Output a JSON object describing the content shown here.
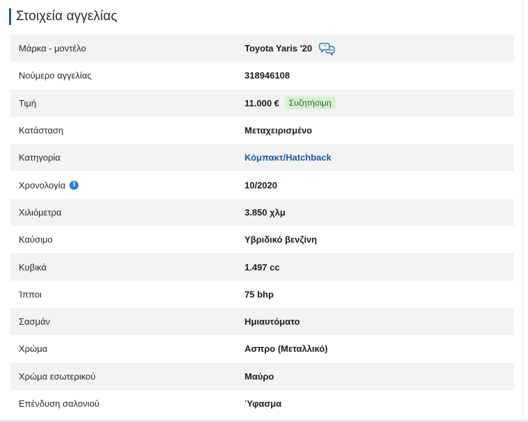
{
  "section": {
    "title": "Στοιχεία αγγελίας",
    "accent_color": "#2354a5"
  },
  "details": {
    "brand_model": {
      "label": "Μάρκα - μοντέλο",
      "value": "Toyota Yaris '20",
      "icon": "chat-bubbles-icon"
    },
    "listing_number": {
      "label": "Νούμερο αγγελίας",
      "value": "318946108"
    },
    "price": {
      "label": "Τιμή",
      "value": "11.000 €",
      "badge": "Συζητήσιμη",
      "badge_color": "#d8f0d4"
    },
    "condition": {
      "label": "Κατάσταση",
      "value": "Μεταχειρισμένο"
    },
    "category": {
      "label": "Κατηγορία",
      "value": "Κόμπακτ/Hatchback",
      "link_color": "#1f55a0"
    },
    "year": {
      "label": "Χρονολογία",
      "value": "10/2020",
      "icon": "info-icon",
      "icon_glyph": "i"
    },
    "mileage": {
      "label": "Χιλιόμετρα",
      "value": "3.850 χλμ"
    },
    "fuel": {
      "label": "Καύσιμο",
      "value": "Υβριδικό βενζίνη"
    },
    "engine": {
      "label": "Κυβικά",
      "value": "1.497 cc"
    },
    "horsepower": {
      "label": "Ίπποι",
      "value": "75 bhp"
    },
    "transmission": {
      "label": "Σασμάν",
      "value": "Ημιαυτόματο"
    },
    "color": {
      "label": "Χρώμα",
      "value": "Ασπρο (Μεταλλικό)"
    },
    "interior_color": {
      "label": "Χρώμα εσωτερικού",
      "value": "Μαύρο"
    },
    "upholstery": {
      "label": "Επένδυση σαλονιού",
      "value": "Ύφασμα"
    }
  }
}
